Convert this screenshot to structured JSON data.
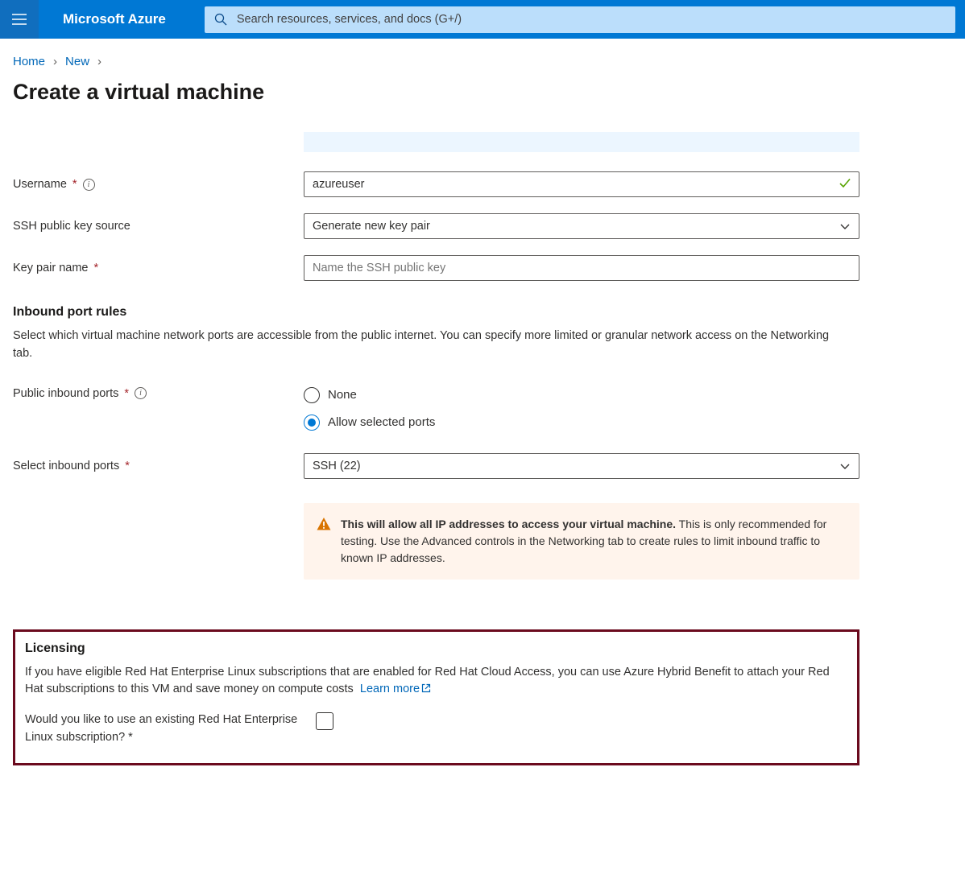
{
  "header": {
    "brand": "Microsoft Azure",
    "search_placeholder": "Search resources, services, and docs (G+/)"
  },
  "breadcrumb": {
    "home": "Home",
    "new": "New"
  },
  "page_title": "Create a virtual machine",
  "form": {
    "username_label": "Username",
    "username_value": "azureuser",
    "ssh_source_label": "SSH public key source",
    "ssh_source_value": "Generate new key pair",
    "keypair_label": "Key pair name",
    "keypair_placeholder": "Name the SSH public key"
  },
  "inbound": {
    "title": "Inbound port rules",
    "desc": "Select which virtual machine network ports are accessible from the public internet. You can specify more limited or granular network access on the Networking tab.",
    "public_label": "Public inbound ports",
    "option_none": "None",
    "option_allow": "Allow selected ports",
    "select_label": "Select inbound ports",
    "select_value": "SSH (22)",
    "warning_bold": "This will allow all IP addresses to access your virtual machine.",
    "warning_rest": "  This is only recommended for testing.  Use the Advanced controls in the Networking tab to create rules to limit inbound traffic to known IP addresses."
  },
  "licensing": {
    "title": "Licensing",
    "desc": "If you have eligible Red Hat Enterprise Linux subscriptions that are enabled for Red Hat Cloud Access, you can use Azure Hybrid Benefit to attach your Red Hat subscriptions to this VM and save money on compute costs",
    "learn_more": "Learn more",
    "checkbox_label": "Would you like to use an existing Red Hat Enterprise Linux subscription?"
  }
}
